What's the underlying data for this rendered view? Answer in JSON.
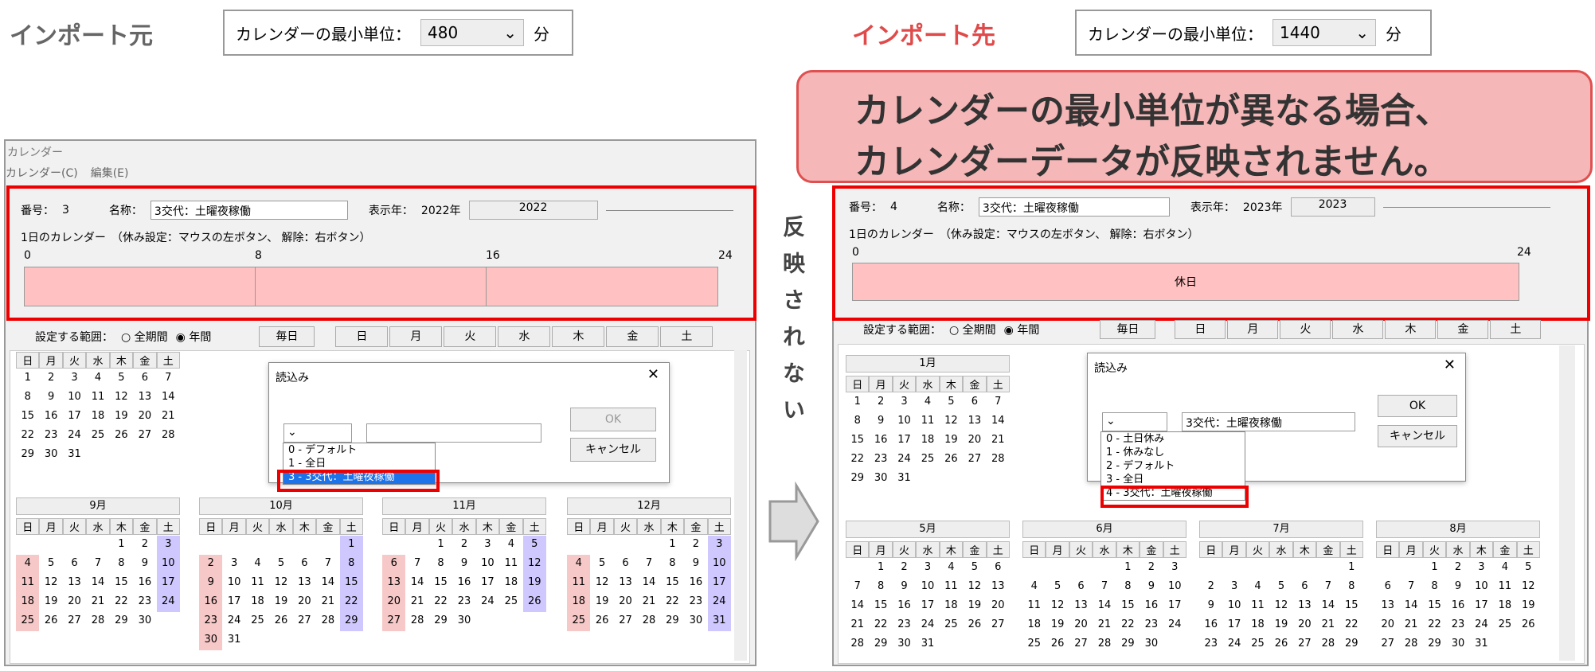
{
  "left": {
    "title": "インポート元",
    "unit_label": "カレンダーの最小単位：",
    "unit_value": "480",
    "unit_suffix": "分",
    "window_title": "カレンダー",
    "menu": [
      "カレンダー(C)",
      "編集(E)"
    ],
    "number_label": "番号：",
    "number_value": "3",
    "name_label": "名称：",
    "name_value": "3交代：土曜夜稼働",
    "year_label": "表示年：",
    "year_value": "2022年",
    "year_input": "2022",
    "day_label": "1日のカレンダー　（休み設定：マウスの左ボタン、 解除：右ボタン）",
    "ticks": [
      "0",
      "8",
      "16",
      "24"
    ],
    "range_label": "設定する範囲：",
    "radio_all": "全期間",
    "radio_year": "年間",
    "everyday": "毎日",
    "weekdays": [
      "日",
      "月",
      "火",
      "水",
      "木",
      "金",
      "土"
    ],
    "dialog": {
      "title": "読込み",
      "ok": "OK",
      "cancel": "キャンセル",
      "items": [
        "0 - デフォルト",
        "1 - 全日",
        "3 - 3交代：土曜夜稼働"
      ]
    }
  },
  "right": {
    "title": "インポート先",
    "unit_label": "カレンダーの最小単位：",
    "unit_value": "1440",
    "unit_suffix": "分",
    "callout_line1": "カレンダーの最小単位が異なる場合、",
    "callout_line2": "カレンダーデータが反映されません。",
    "number_label": "番号：",
    "number_value": "4",
    "name_label": "名称：",
    "name_value": "3交代：土曜夜稼働",
    "year_label": "表示年：",
    "year_value": "2023年",
    "year_input": "2023",
    "day_label": "1日のカレンダー　（休み設定：マウスの左ボタン、 解除：右ボタン）",
    "ticks": [
      "0",
      "24"
    ],
    "holiday": "休日",
    "range_label": "設定する範囲：",
    "radio_all": "全期間",
    "radio_year": "年間",
    "everyday": "毎日",
    "weekdays": [
      "日",
      "月",
      "火",
      "水",
      "木",
      "金",
      "土"
    ],
    "dialog": {
      "title": "読込み",
      "ok": "OK",
      "cancel": "キャンセル",
      "selected_text": "3交代：土曜夜稼働",
      "items": [
        "0 - 土日休み",
        "1 - 休みなし",
        "2 - デフォルト",
        "3 - 全日",
        "4 - 3交代：土曜夜稼働"
      ]
    }
  },
  "middle_text": "反映されない",
  "months_left": [
    "9月",
    "10月",
    "11月",
    "12月"
  ],
  "months_right": [
    "1月",
    "5月",
    "6月",
    "7月",
    "8月"
  ],
  "colors": {
    "highlight": "#e00000",
    "holiday": "#ffc1c1",
    "saturday": "#cfc8ff",
    "sunday": "#f7c8c8"
  }
}
